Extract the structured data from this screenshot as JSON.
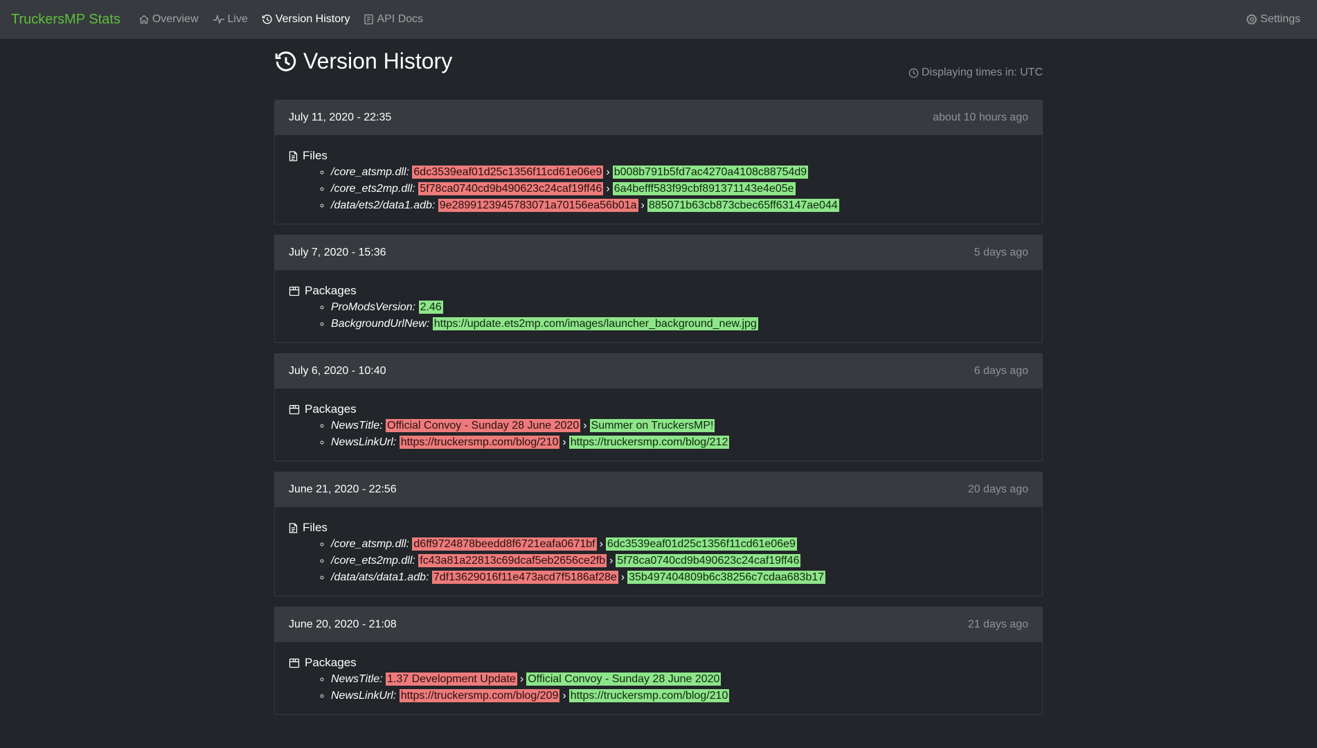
{
  "nav": {
    "brand": "TruckersMP Stats",
    "links": [
      {
        "label": "Overview",
        "icon": "home-icon",
        "active": false
      },
      {
        "label": "Live",
        "icon": "pulse-icon",
        "active": false
      },
      {
        "label": "Version History",
        "icon": "history-icon",
        "active": true
      },
      {
        "label": "API Docs",
        "icon": "book-icon",
        "active": false
      }
    ],
    "settings_label": "Settings"
  },
  "page": {
    "title": "Version History",
    "timezone_note": "Displaying times in: UTC"
  },
  "colors": {
    "brand": "#5fbf3c",
    "old_value_bg": "#ee7b7b",
    "new_value_bg": "#8ee58a",
    "card_header_bg": "#373a3f",
    "page_bg": "#222529"
  },
  "entries": [
    {
      "date": "July 11, 2020 - 22:35",
      "ago": "about 10 hours ago",
      "section": "Files",
      "section_icon": "file-icon",
      "changes": [
        {
          "key": "/core_atsmp.dll:",
          "old": "6dc3539eaf01d25c1356f11cd61e06e9",
          "new": "b008b791b5fd7ac4270a4108c88754d9"
        },
        {
          "key": "/core_ets2mp.dll:",
          "old": "5f78ca0740cd9b490623c24caf19ff46",
          "new": "6a4befff583f99cbf891371143e4e05e"
        },
        {
          "key": "/data/ets2/data1.adb:",
          "old": "9e2899123945783071a70156ea56b01a",
          "new": "885071b63cb873cbec65ff63147ae044"
        }
      ]
    },
    {
      "date": "July 7, 2020 - 15:36",
      "ago": "5 days ago",
      "section": "Packages",
      "section_icon": "package-icon",
      "changes": [
        {
          "key": "ProModsVersion:",
          "old": "",
          "new": "2.46"
        },
        {
          "key": "BackgroundUrlNew:",
          "old": "",
          "new": "https://update.ets2mp.com/images/launcher_background_new.jpg"
        }
      ]
    },
    {
      "date": "July 6, 2020 - 10:40",
      "ago": "6 days ago",
      "section": "Packages",
      "section_icon": "package-icon",
      "changes": [
        {
          "key": "NewsTitle:",
          "old": "Official Convoy - Sunday 28 June 2020",
          "new": "Summer on TruckersMP!"
        },
        {
          "key": "NewsLinkUrl:",
          "old": "https://truckersmp.com/blog/210",
          "new": "https://truckersmp.com/blog/212"
        }
      ]
    },
    {
      "date": "June 21, 2020 - 22:56",
      "ago": "20 days ago",
      "section": "Files",
      "section_icon": "file-icon",
      "changes": [
        {
          "key": "/core_atsmp.dll:",
          "old": "d6ff9724878beedd8f6721eafa0671bf",
          "new": "6dc3539eaf01d25c1356f11cd61e06e9"
        },
        {
          "key": "/core_ets2mp.dll:",
          "old": "fc43a81a22813c69dcaf5eb2656ce2fb",
          "new": "5f78ca0740cd9b490623c24caf19ff46"
        },
        {
          "key": "/data/ats/data1.adb:",
          "old": "7df13629016f11e473acd7f5186af28e",
          "new": "35b497404809b6c38256c7cdaa683b17"
        }
      ]
    },
    {
      "date": "June 20, 2020 - 21:08",
      "ago": "21 days ago",
      "section": "Packages",
      "section_icon": "package-icon",
      "changes": [
        {
          "key": "NewsTitle:",
          "old": "1.37 Development Update",
          "new": "Official Convoy - Sunday 28 June 2020"
        },
        {
          "key": "NewsLinkUrl:",
          "old": "https://truckersmp.com/blog/209",
          "new": "https://truckersmp.com/blog/210"
        }
      ]
    }
  ]
}
